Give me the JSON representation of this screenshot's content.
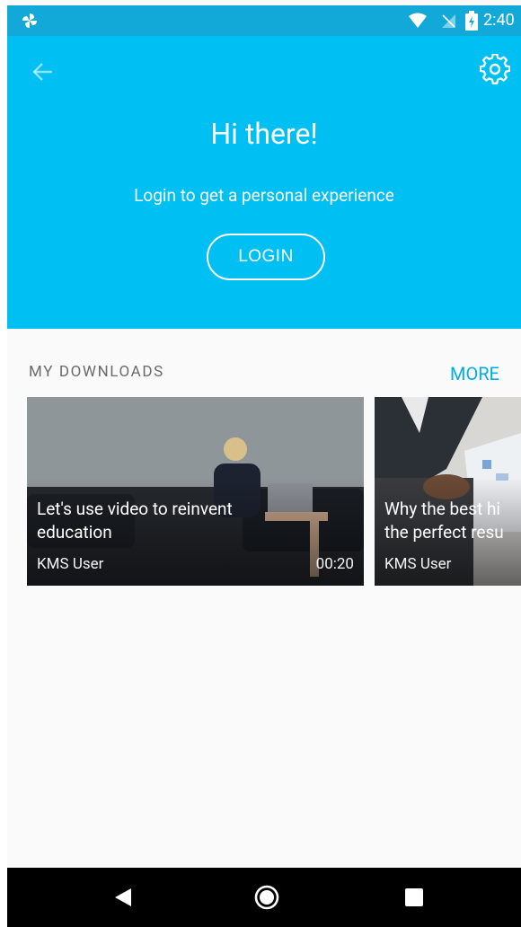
{
  "status_bar": {
    "time": "2:40",
    "app_icon": "pinwheel-icon",
    "wifi_icon": "wifi-icon",
    "signal_icon": "no-signal-icon",
    "battery_icon": "battery-charging-icon"
  },
  "header": {
    "back_icon": "arrow-left-icon",
    "settings_icon": "gear-icon",
    "greeting": "Hi there!",
    "subtitle": "Login to get a personal experience",
    "login_label": "LOGIN"
  },
  "downloads": {
    "title": "MY DOWNLOADS",
    "more_label": "MORE",
    "items": [
      {
        "title": "Let's use video to reinvent education",
        "author": "KMS User",
        "duration": "00:20"
      },
      {
        "title_line1": "Why the best hi",
        "title_line2": "the perfect resu",
        "author": "KMS User"
      }
    ]
  },
  "nav_bar": {
    "back_icon": "triangle-back-icon",
    "home_icon": "circle-home-icon",
    "recent_icon": "square-recents-icon"
  },
  "colors": {
    "status_bar": "#12a9d8",
    "header": "#00bff3",
    "accent": "#00aee8",
    "background": "#fafafa"
  }
}
